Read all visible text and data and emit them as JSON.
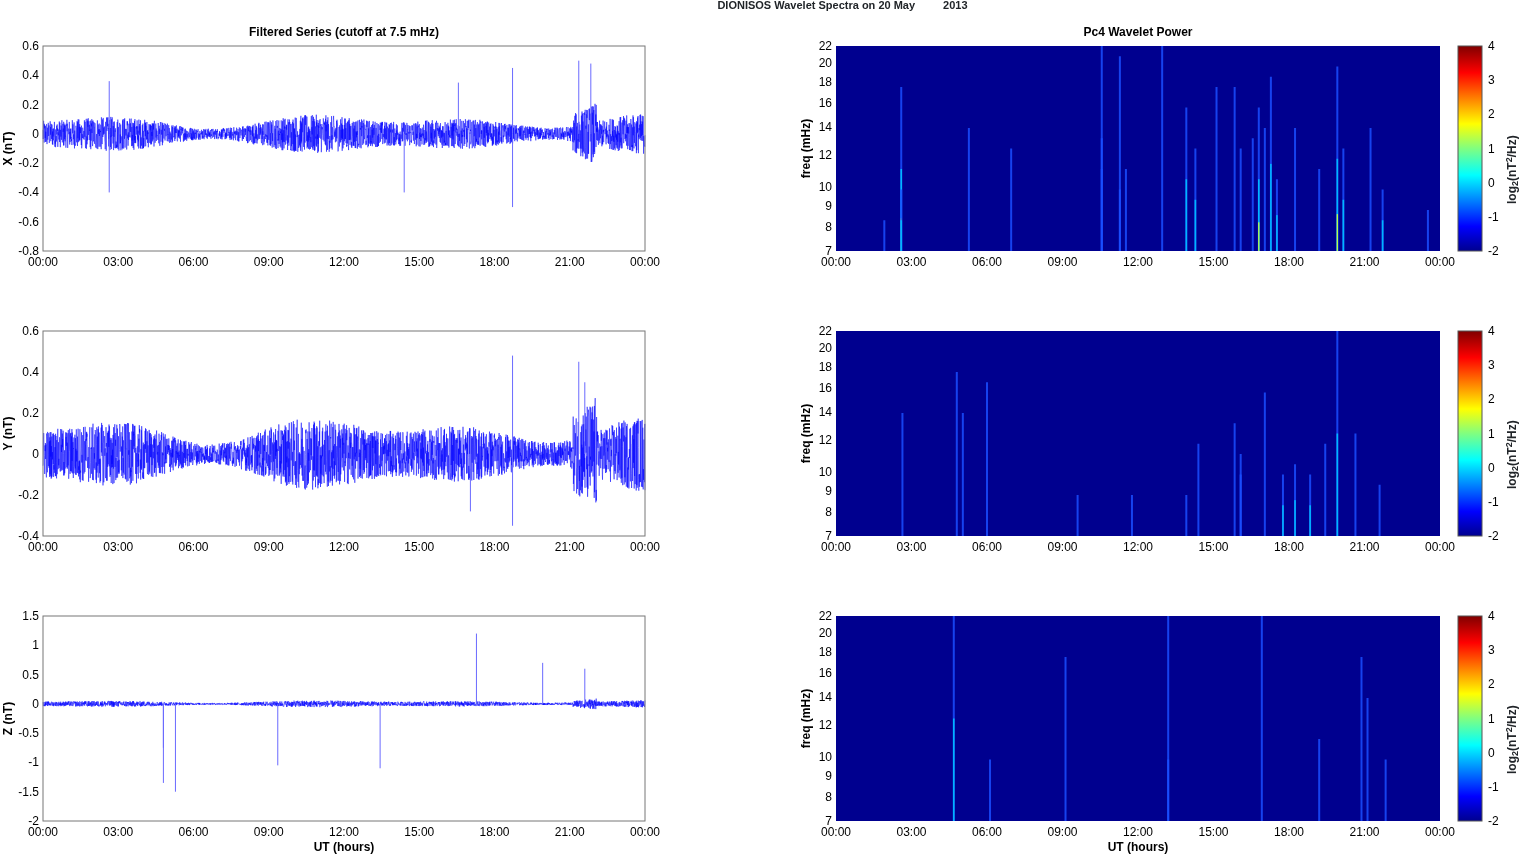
{
  "figure": {
    "title": "DIONISOS Wavelet Spectra on 20 May",
    "title_2": "2013"
  },
  "left_title": "Filtered Series (cutoff at 7.5 mHz)",
  "right_title": "Pc4 Wavelet Power",
  "rows": [
    {
      "series": {
        "ylabel": "X (nT)",
        "yticks": [
          "0.6",
          "0.4",
          "0.2",
          "0",
          "-0.2",
          "-0.4",
          "-0.6",
          "-0.8"
        ],
        "xticks": [
          "00:00",
          "03:00",
          "06:00",
          "09:00",
          "12:00",
          "15:00",
          "18:00",
          "21:00",
          "00:00"
        ]
      },
      "spectrum": {
        "ylabel": "freq (mHz)",
        "yticks": [
          "22",
          "20",
          "18",
          "16",
          "14",
          "12",
          "10",
          "9",
          "8",
          "7"
        ],
        "xticks": [
          "00:00",
          "03:00",
          "06:00",
          "09:00",
          "12:00",
          "15:00",
          "18:00",
          "21:00",
          "00:00"
        ],
        "colorbar": {
          "ticks": [
            "4",
            "3",
            "2",
            "1",
            "0",
            "-1",
            "-2"
          ],
          "label": "log$_{2}$(nT$^{2}$/Hz)"
        }
      }
    },
    {
      "series": {
        "ylabel": "Y (nT)",
        "yticks": [
          "0.6",
          "0.4",
          "0.2",
          "0",
          "-0.2",
          "-0.4"
        ],
        "xticks": [
          "00:00",
          "03:00",
          "06:00",
          "09:00",
          "12:00",
          "15:00",
          "18:00",
          "21:00",
          "00:00"
        ]
      },
      "spectrum": {
        "ylabel": "freq (mHz)",
        "yticks": [
          "22",
          "20",
          "18",
          "16",
          "14",
          "12",
          "10",
          "9",
          "8",
          "7"
        ],
        "xticks": [
          "00:00",
          "03:00",
          "06:00",
          "09:00",
          "12:00",
          "15:00",
          "18:00",
          "21:00",
          "00:00"
        ],
        "colorbar": {
          "ticks": [
            "4",
            "3",
            "2",
            "1",
            "0",
            "-1",
            "-2"
          ],
          "label": "log$_{2}$(nT$^{2}$/Hz)"
        }
      }
    },
    {
      "series": {
        "ylabel": "Z (nT)",
        "yticks": [
          "1.5",
          "1",
          "0.5",
          "0",
          "-0.5",
          "-1",
          "-1.5",
          "-2"
        ],
        "xticks": [
          "00:00",
          "03:00",
          "06:00",
          "09:00",
          "12:00",
          "15:00",
          "18:00",
          "21:00",
          "00:00"
        ],
        "xlabel": "UT (hours)"
      },
      "spectrum": {
        "ylabel": "freq (mHz)",
        "yticks": [
          "22",
          "20",
          "18",
          "16",
          "14",
          "12",
          "10",
          "9",
          "8",
          "7"
        ],
        "xticks": [
          "00:00",
          "03:00",
          "06:00",
          "09:00",
          "12:00",
          "15:00",
          "18:00",
          "21:00",
          "00:00"
        ],
        "xlabel": "UT (hours)",
        "colorbar": {
          "ticks": [
            "4",
            "3",
            "2",
            "1",
            "0",
            "-1",
            "-2"
          ],
          "label": "log$_{2}$(nT$^{2}$/Hz)"
        }
      }
    }
  ]
}
